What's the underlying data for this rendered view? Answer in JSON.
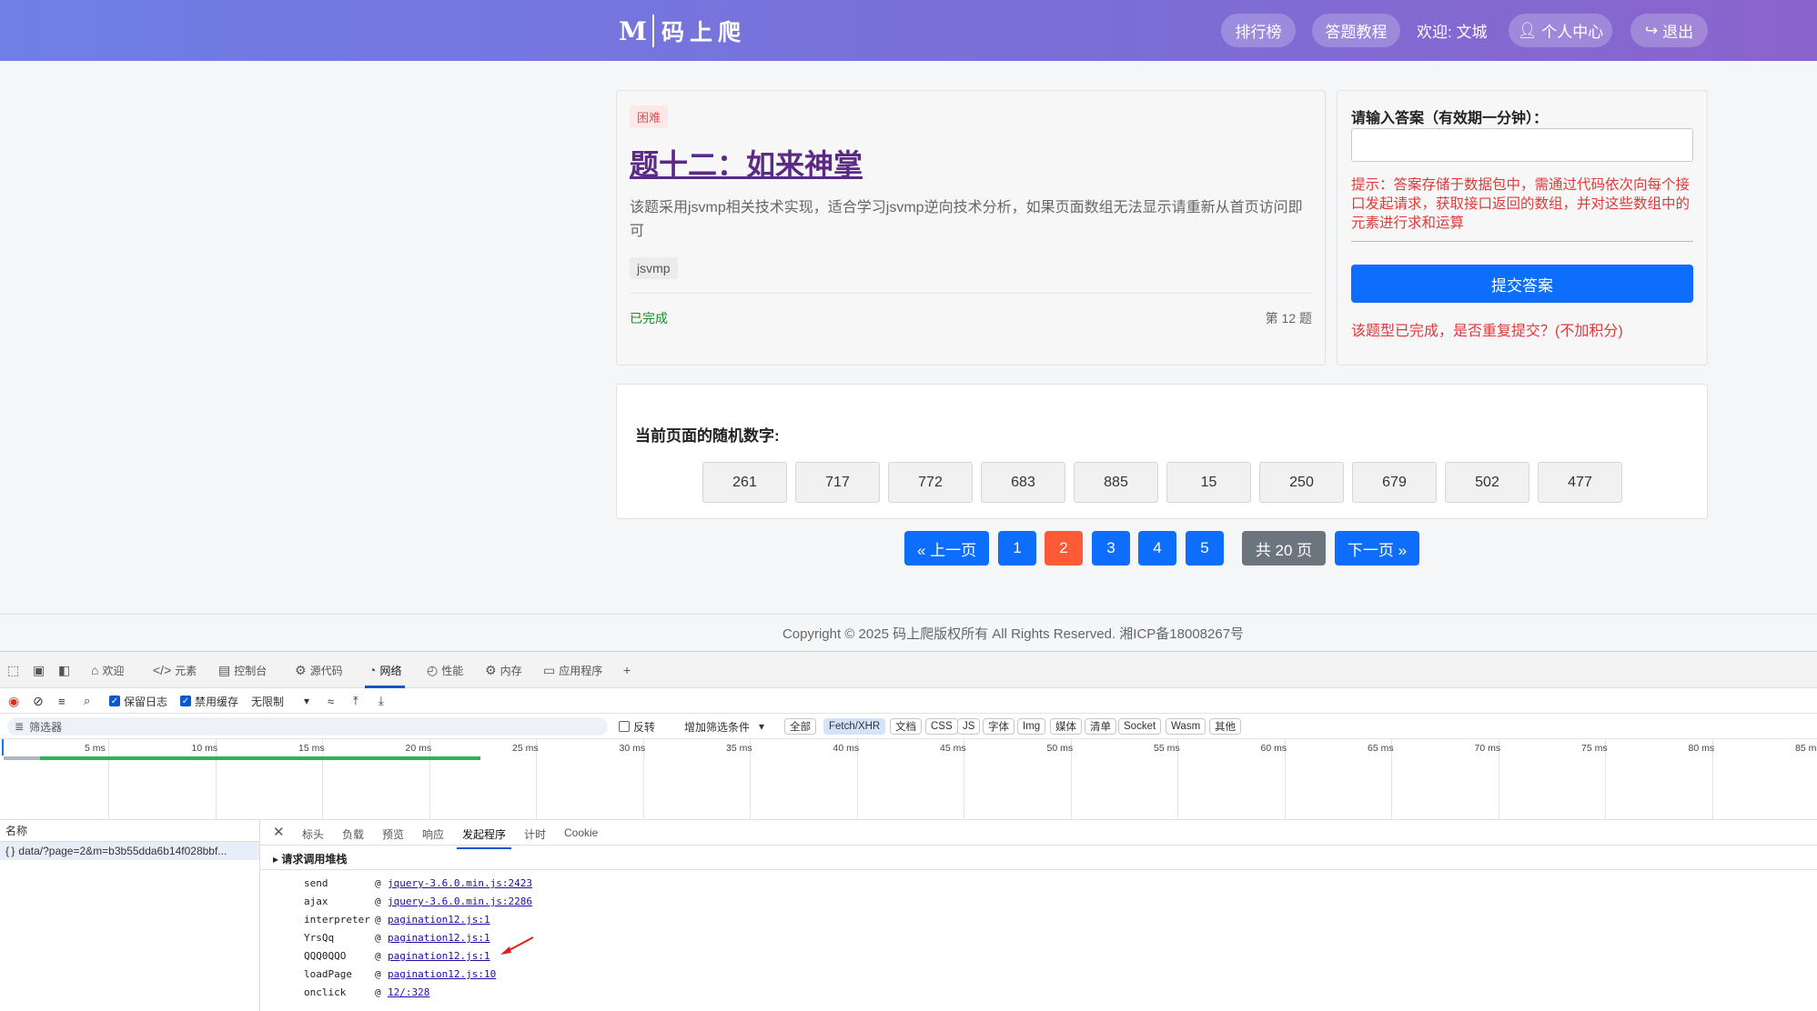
{
  "header": {
    "logo_mark": "M",
    "logo_text": "码上爬",
    "nav": {
      "rank": "排行榜",
      "tutorial": "答题教程",
      "welcome": "欢迎: 文城",
      "profile": "个人中心",
      "logout": "退出"
    }
  },
  "question": {
    "difficulty": "困难",
    "title": "题十二：如来神掌",
    "description": "该题采用jsvmp相关技术实现，适合学习jsvmp逆向技术分析，如果页面数组无法显示请重新从首页访问即可",
    "tag": "jsvmp",
    "status": "已完成",
    "number": "第 12 题"
  },
  "answer": {
    "label": "请输入答案（有效期一分钟）：",
    "input_value": "",
    "hint": "提示：答案存储于数据包中，需通过代码依次向每个接口发起请求，获取接口返回的数组，并对这些数组中的元素进行求和运算",
    "submit": "提交答案",
    "repeat_msg": "该题型已完成，是否重复提交？(不加积分)"
  },
  "random": {
    "label": "当前页面的随机数字:",
    "numbers": [
      "261",
      "717",
      "772",
      "683",
      "885",
      "15",
      "250",
      "679",
      "502",
      "477"
    ]
  },
  "pagination": {
    "prev": "« 上一页",
    "pages": [
      "1",
      "2",
      "3",
      "4",
      "5"
    ],
    "current": "2",
    "total": "共 20 页",
    "next": "下一页 »"
  },
  "footer": {
    "copyright": "Copyright © 2025 码上爬版权所有 All Rights Reserved. 湘ICP备18008267号"
  },
  "devtools": {
    "tabs": [
      "欢迎",
      "元素",
      "控制台",
      "源代码",
      "网络",
      "性能",
      "内存",
      "应用程序"
    ],
    "active_tab": "网络",
    "toolbar": {
      "preserve_log": "保留日志",
      "disable_cache": "禁用缓存",
      "throttle": "无限制"
    },
    "filter": {
      "placeholder": "筛选器",
      "invert": "反转",
      "more_filters": "增加筛选条件",
      "chips": [
        "全部",
        "Fetch/XHR",
        "文档",
        "CSS",
        "JS",
        "字体",
        "Img",
        "媒体",
        "清单",
        "Socket",
        "Wasm",
        "其他"
      ],
      "selected_chip": "Fetch/XHR"
    },
    "timeline_ticks": [
      "5 ms",
      "10 ms",
      "15 ms",
      "20 ms",
      "25 ms",
      "30 ms",
      "35 ms",
      "40 ms",
      "45 ms",
      "50 ms",
      "55 ms",
      "60 ms",
      "65 ms",
      "70 ms",
      "75 ms",
      "80 ms",
      "85 ms"
    ],
    "name_header": "名称",
    "request": "data/?page=2&m=b3b55dda6b14f028bbf...",
    "detail_tabs": [
      "标头",
      "负载",
      "预览",
      "响应",
      "发起程序",
      "计时",
      "Cookie"
    ],
    "active_detail_tab": "发起程序",
    "stack_title": "请求调用堆栈",
    "stack": [
      {
        "fn": "send",
        "loc": "jquery-3.6.0.min.js:2423"
      },
      {
        "fn": "ajax",
        "loc": "jquery-3.6.0.min.js:2286"
      },
      {
        "fn": "interpreter",
        "loc": "pagination12.js:1"
      },
      {
        "fn": "YrsQq",
        "loc": "pagination12.js:1"
      },
      {
        "fn": "QQQ0QQO",
        "loc": "pagination12.js:1"
      },
      {
        "fn": "loadPage",
        "loc": "pagination12.js:10"
      },
      {
        "fn": "onclick",
        "loc": "12/:328"
      }
    ]
  },
  "colors": {
    "nav_gradient_start": "#6f7fe6",
    "nav_gradient_end": "#8a64cc",
    "primary": "#0d6efd",
    "active_page": "#ff5a36",
    "danger_text": "#e03a3a",
    "title_purple": "#5b2a86"
  }
}
